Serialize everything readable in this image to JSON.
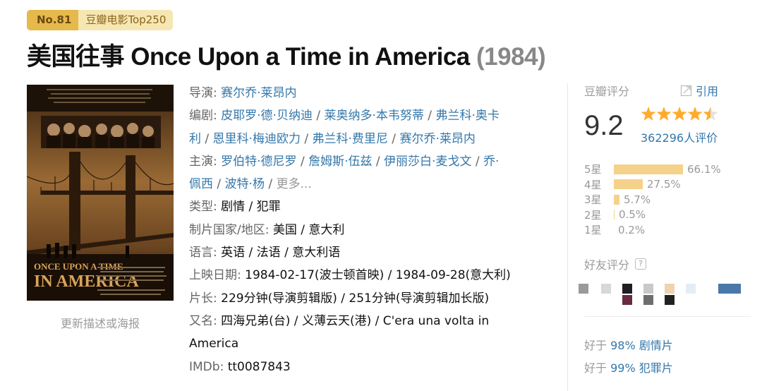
{
  "badge": {
    "rank": "No.81",
    "list": "豆瓣电影Top250"
  },
  "title": {
    "main": "美国往事 Once Upon a Time in America",
    "year": "(1984)"
  },
  "poster": {
    "link_text": "更新描述或海报",
    "poster_title": "ONCE UPON A TIME IN AMERICA"
  },
  "info": {
    "director_label": "导演",
    "director": "赛尔乔·莱昂内",
    "writer_label": "编剧",
    "writers": [
      "皮耶罗·德·贝纳迪",
      "莱奥纳多·本韦努蒂",
      "弗兰科·奥卡",
      "利",
      "恩里科·梅迪欧力",
      "弗兰科·费里尼",
      "赛尔乔·莱昂内"
    ],
    "cast_label": "主演",
    "cast": [
      "罗伯特·德尼罗",
      "詹姆斯·伍兹",
      "伊丽莎白·麦戈文",
      "乔·",
      "佩西",
      "波特·杨"
    ],
    "more": "更多...",
    "genre_label": "类型:",
    "genre": "剧情 / 犯罪",
    "country_label": "制片国家/地区:",
    "country": "美国 / 意大利",
    "language_label": "语言:",
    "language": "英语 / 法语 / 意大利语",
    "release_label": "上映日期:",
    "release": "1984-02-17(波士顿首映) / 1984-09-28(意大利)",
    "runtime_label": "片长:",
    "runtime": "229分钟(导演剪辑版) / 251分钟(导演剪辑加长版)",
    "aka_label": "又名:",
    "aka_line1": "四海兄弟(台) / 义薄云天(港) / C'era una volta in",
    "aka_line2": "America",
    "imdb_label": "IMDb:",
    "imdb": "tt0087843"
  },
  "rating": {
    "header": "豆瓣评分",
    "cite": "引用",
    "score": "9.2",
    "stars_value": 4.5,
    "votes": "362296人评价",
    "distribution": [
      {
        "label": "5星",
        "pct": "66.1%",
        "value": 66.1
      },
      {
        "label": "4星",
        "pct": "27.5%",
        "value": 27.5
      },
      {
        "label": "3星",
        "pct": "5.7%",
        "value": 5.7
      },
      {
        "label": "2星",
        "pct": "0.5%",
        "value": 0.5
      },
      {
        "label": "1星",
        "pct": "0.2%",
        "value": 0.2
      }
    ]
  },
  "friends": {
    "header": "好友评分",
    "help": "?"
  },
  "better_than": [
    {
      "prefix": "好于",
      "pct": "98%",
      "genre": "剧情片"
    },
    {
      "prefix": "好于",
      "pct": "99%",
      "genre": "犯罪片"
    }
  ],
  "colors": {
    "link": "#3377aa",
    "star": "#ffac2d",
    "bar": "#f4d28a",
    "badge_dark": "#e6b94c",
    "badge_light": "#f6e6b2"
  }
}
